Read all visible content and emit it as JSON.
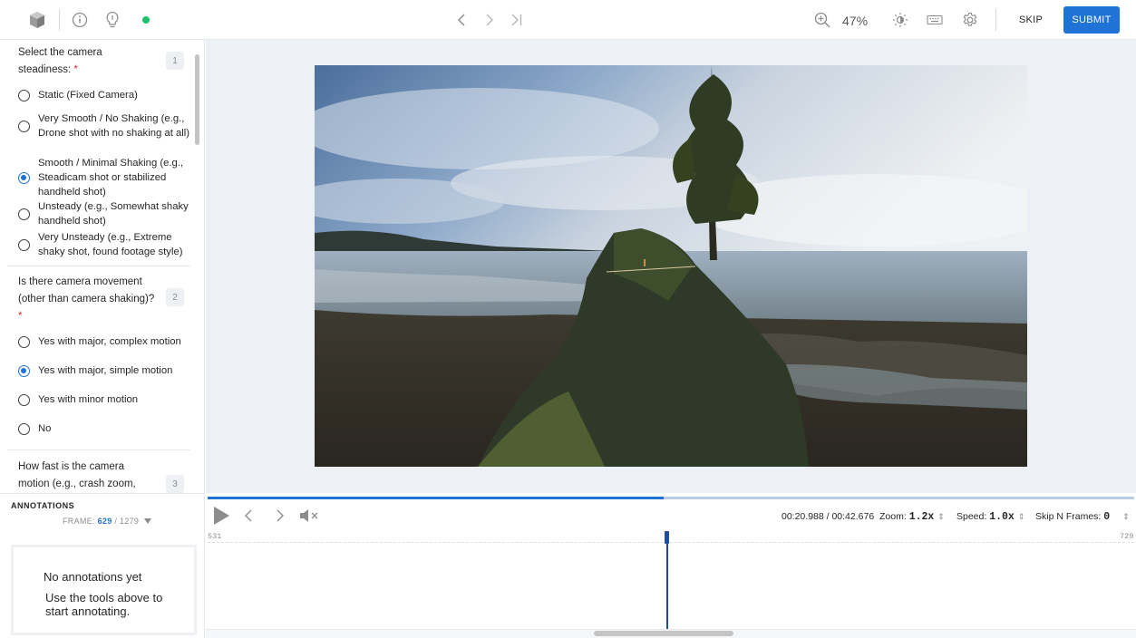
{
  "topbar": {
    "left_icons": [
      "cube-icon",
      "info-icon",
      "lightbulb-icon"
    ],
    "status_color": "#1ec26a",
    "nav_icons": [
      "chevron-left-icon",
      "chevron-right-icon",
      "skip-to-end-icon"
    ],
    "zoom_icon": "zoom-in-icon",
    "zoom": "47%",
    "right_icons": [
      "brightness-icon",
      "keyboard-icon",
      "gear-icon"
    ],
    "skip_label": "SKIP",
    "submit_label": "SUBMIT"
  },
  "questions": [
    {
      "number": "1",
      "title_lines": [
        "Select the camera",
        "steadiness:"
      ],
      "required": "*",
      "options": [
        {
          "label": "Static (Fixed Camera)",
          "selected": false
        },
        {
          "label": "Very Smooth / No Shaking (e.g., Drone shot with no shaking at all)",
          "selected": false
        },
        {
          "label": "Smooth / Minimal Shaking (e.g., Steadicam shot or stabilized handheld shot)",
          "selected": true
        },
        {
          "label": "Unsteady (e.g., Somewhat shaky handheld shot)",
          "selected": false
        },
        {
          "label": "Very Unsteady (e.g., Extreme shaky shot, found footage style)",
          "selected": false
        }
      ]
    },
    {
      "number": "2",
      "title_lines": [
        "Is there camera movement",
        "(other than camera shaking)?"
      ],
      "required": "*",
      "options": [
        {
          "label": "Yes with major, complex motion",
          "selected": false
        },
        {
          "label": "Yes with major, simple motion",
          "selected": true
        },
        {
          "label": "Yes with minor motion",
          "selected": false
        },
        {
          "label": "No",
          "selected": false
        }
      ]
    },
    {
      "number": "3",
      "title_lines": [
        "How fast is the camera",
        "motion (e.g., crash zoom,"
      ]
    }
  ],
  "annotations": {
    "title": "ANNOTATIONS",
    "frame_prefix": "FRAME:",
    "frame_current": "629",
    "frame_total": "/ 1279",
    "empty_title": "No annotations yet",
    "empty_desc": "Use the tools above to start annotating."
  },
  "player": {
    "progress": 0.492,
    "time": "00:20.988 / 00:42.676",
    "zoom_label": "Zoom:",
    "zoom_value": "1.2x",
    "speed_label": "Speed:",
    "speed_value": "1.0x",
    "skip_label": "Skip N Frames:",
    "skip_value": "0",
    "range_start": "531",
    "range_end": "729",
    "controls": [
      "play-icon",
      "previous-frame-icon",
      "next-frame-icon",
      "mute-icon"
    ]
  }
}
